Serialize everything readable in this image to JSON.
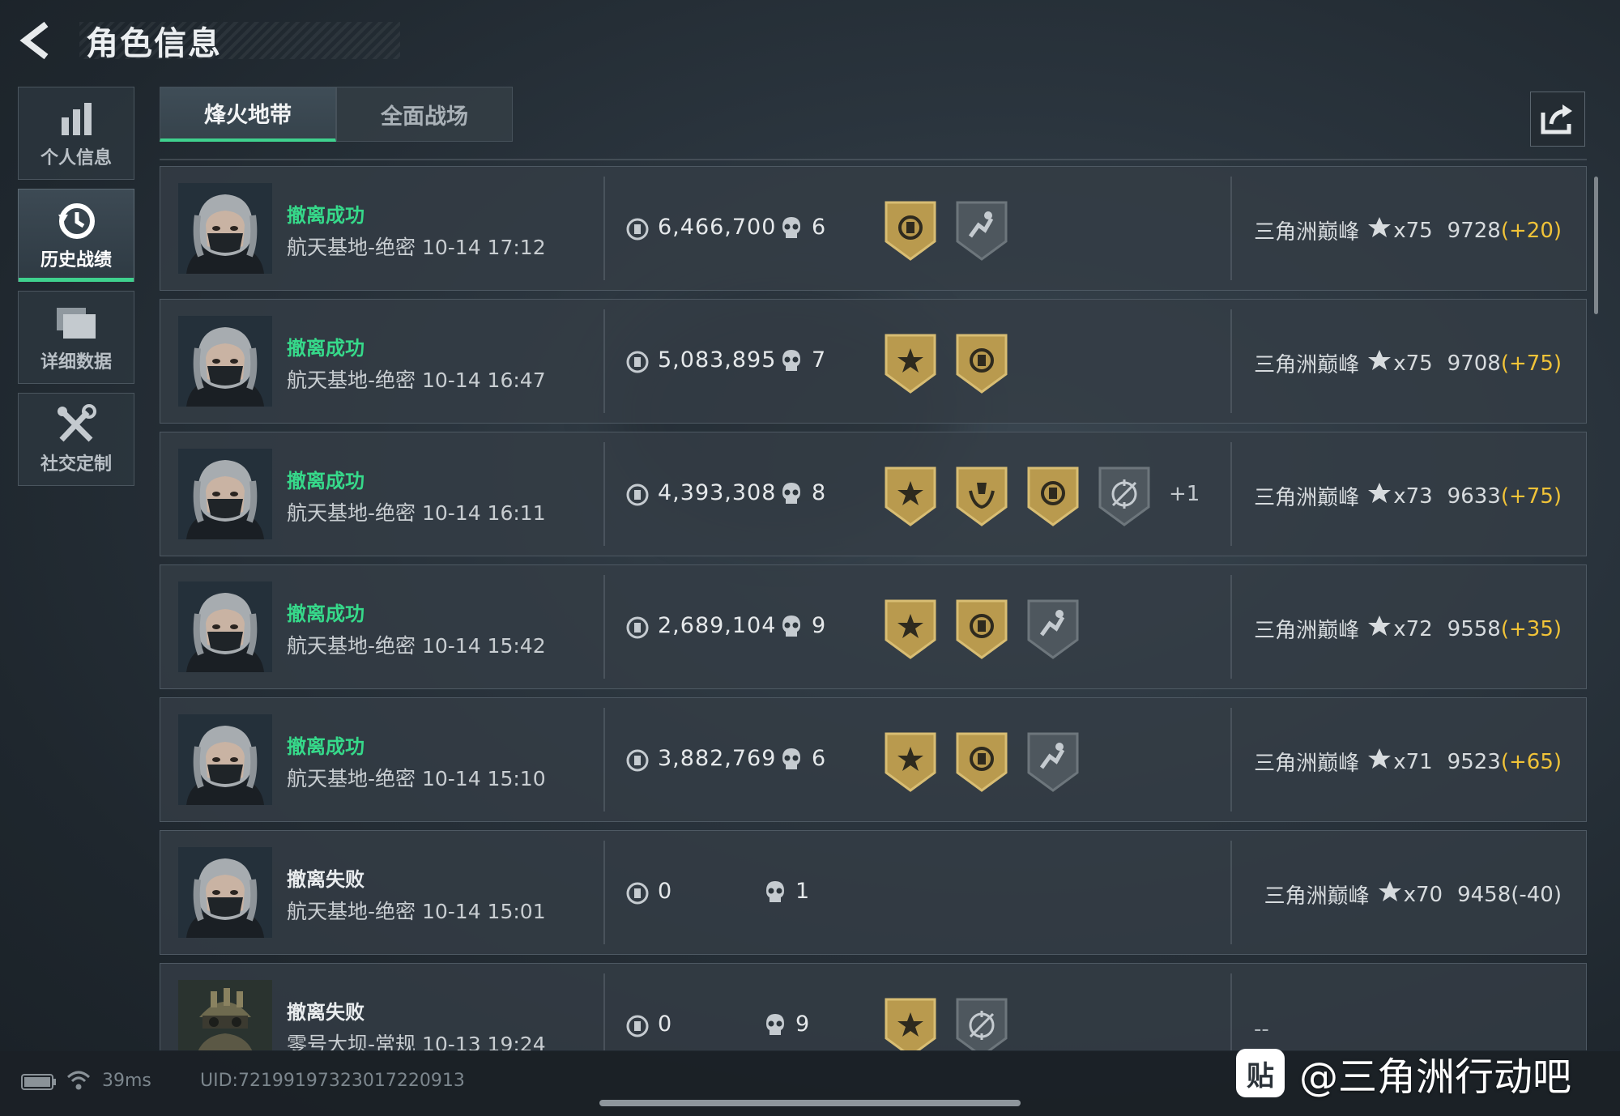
{
  "header": {
    "title": "角色信息"
  },
  "sidebar": {
    "items": [
      {
        "label": "个人信息",
        "icon": "bar-chart-icon",
        "active": false
      },
      {
        "label": "历史战绩",
        "icon": "history-clock-icon",
        "active": true
      },
      {
        "label": "详细数据",
        "icon": "folder-icon",
        "active": false
      },
      {
        "label": "社交定制",
        "icon": "tools-icon",
        "active": false
      }
    ]
  },
  "tabs": [
    {
      "label": "烽火地带",
      "active": true
    },
    {
      "label": "全面战场",
      "active": false
    }
  ],
  "colors": {
    "accent_green": "#3fd18e",
    "success_text": "#36d98a",
    "delta_gold": "#f1c338",
    "badge_gold": "#b99a4e",
    "badge_gray": "#4e575e"
  },
  "matches": [
    {
      "status": "撤离成功",
      "success": true,
      "map": "航天基地-绝密 10-14 17:12",
      "money": "6,466,700",
      "kills": "6",
      "badges": [
        "gold-shield-emblem-icon",
        "gray-runner-emblem-icon"
      ],
      "extra": "",
      "rank_name": "三角洲巅峰",
      "stars": "x75",
      "score": "9728",
      "delta": "(+20)",
      "delta_positive": true
    },
    {
      "status": "撤离成功",
      "success": true,
      "map": "航天基地-绝密 10-14 16:47",
      "money": "5,083,895",
      "kills": "7",
      "badges": [
        "gold-star-emblem-icon",
        "gold-shield-emblem-icon"
      ],
      "extra": "",
      "rank_name": "三角洲巅峰",
      "stars": "x75",
      "score": "9708",
      "delta": "(+75)",
      "delta_positive": true
    },
    {
      "status": "撤离成功",
      "success": true,
      "map": "航天基地-绝密 10-14 16:11",
      "money": "4,393,308",
      "kills": "8",
      "badges": [
        "gold-star-emblem-icon",
        "gold-wreath-emblem-icon",
        "gold-shield-emblem-icon",
        "gray-crosshair-emblem-icon"
      ],
      "extra": "+1",
      "rank_name": "三角洲巅峰",
      "stars": "x73",
      "score": "9633",
      "delta": "(+75)",
      "delta_positive": true
    },
    {
      "status": "撤离成功",
      "success": true,
      "map": "航天基地-绝密 10-14 15:42",
      "money": "2,689,104",
      "kills": "9",
      "badges": [
        "gold-star-emblem-icon",
        "gold-shield-emblem-icon",
        "gray-runner-emblem-icon"
      ],
      "extra": "",
      "rank_name": "三角洲巅峰",
      "stars": "x72",
      "score": "9558",
      "delta": "(+35)",
      "delta_positive": true
    },
    {
      "status": "撤离成功",
      "success": true,
      "map": "航天基地-绝密 10-14 15:10",
      "money": "3,882,769",
      "kills": "6",
      "badges": [
        "gold-star-emblem-icon",
        "gold-shield-emblem-icon",
        "gray-runner-emblem-icon"
      ],
      "extra": "",
      "rank_name": "三角洲巅峰",
      "stars": "x71",
      "score": "9523",
      "delta": "(+65)",
      "delta_positive": true
    },
    {
      "status": "撤离失败",
      "success": false,
      "map": "航天基地-绝密 10-14 15:01",
      "money": "0",
      "kills": "1",
      "badges": [],
      "extra": "",
      "rank_name": "三角洲巅峰",
      "stars": "x70",
      "score": "9458",
      "delta": "(-40)",
      "delta_positive": false
    },
    {
      "status": "撤离失败",
      "success": false,
      "map": "零号大坝-常规 10-13 19:24",
      "money": "0",
      "kills": "9",
      "badges": [
        "gold-star-emblem-icon",
        "gray-crosshair-emblem-icon"
      ],
      "extra": "",
      "rank_dash": "--",
      "avatar": "soldier-helmet"
    }
  ],
  "footer": {
    "ping": "39ms",
    "uid": "UID:72199197323017220913"
  },
  "watermark": {
    "logo": "贴",
    "text": "@三角洲行动吧"
  }
}
